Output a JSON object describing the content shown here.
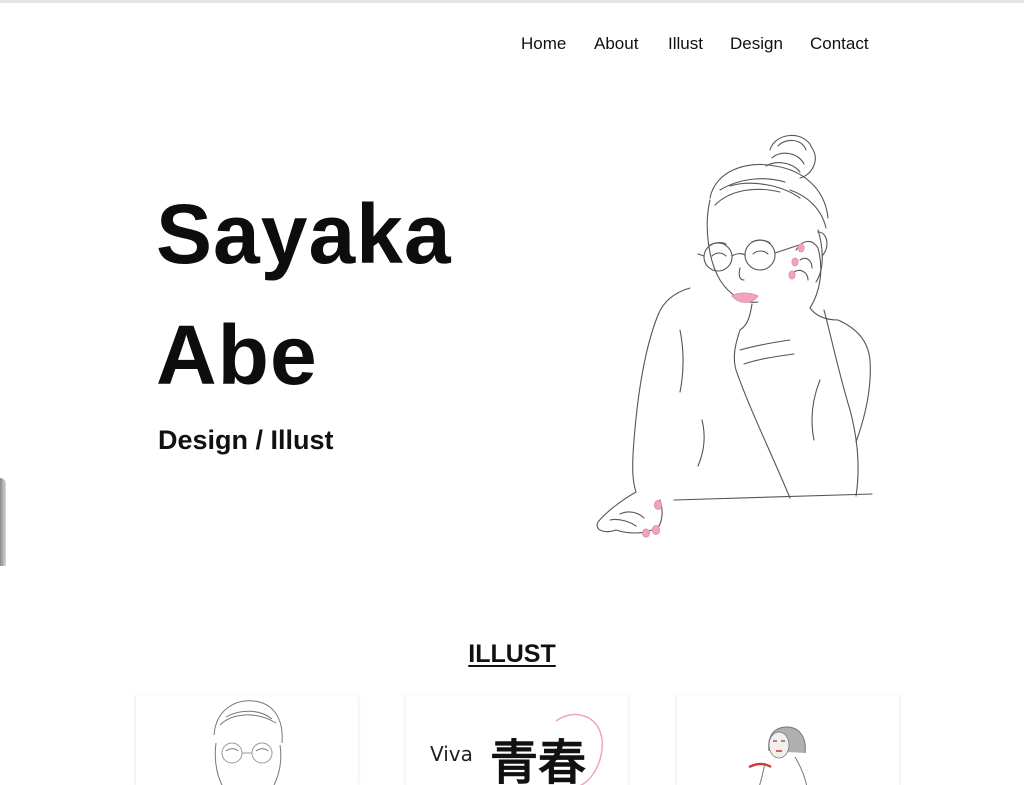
{
  "nav": {
    "items": [
      {
        "label": "Home"
      },
      {
        "label": "About"
      },
      {
        "label": "Illust"
      },
      {
        "label": "Design"
      },
      {
        "label": "Contact"
      }
    ]
  },
  "hero": {
    "first_name": "Sayaka",
    "last_name": "Abe",
    "subtitle": "Design / Illust"
  },
  "illust_section": {
    "title": "ILLUST",
    "cards": [
      {
        "name": "illust-card-glasses-woman"
      },
      {
        "name": "illust-card-seishun",
        "small_text": "Viva",
        "large_text": "青春"
      },
      {
        "name": "illust-card-woman-red"
      }
    ]
  },
  "colors": {
    "text": "#111111",
    "accent_pink": "#f2a3c0",
    "line_gray": "#555555"
  }
}
